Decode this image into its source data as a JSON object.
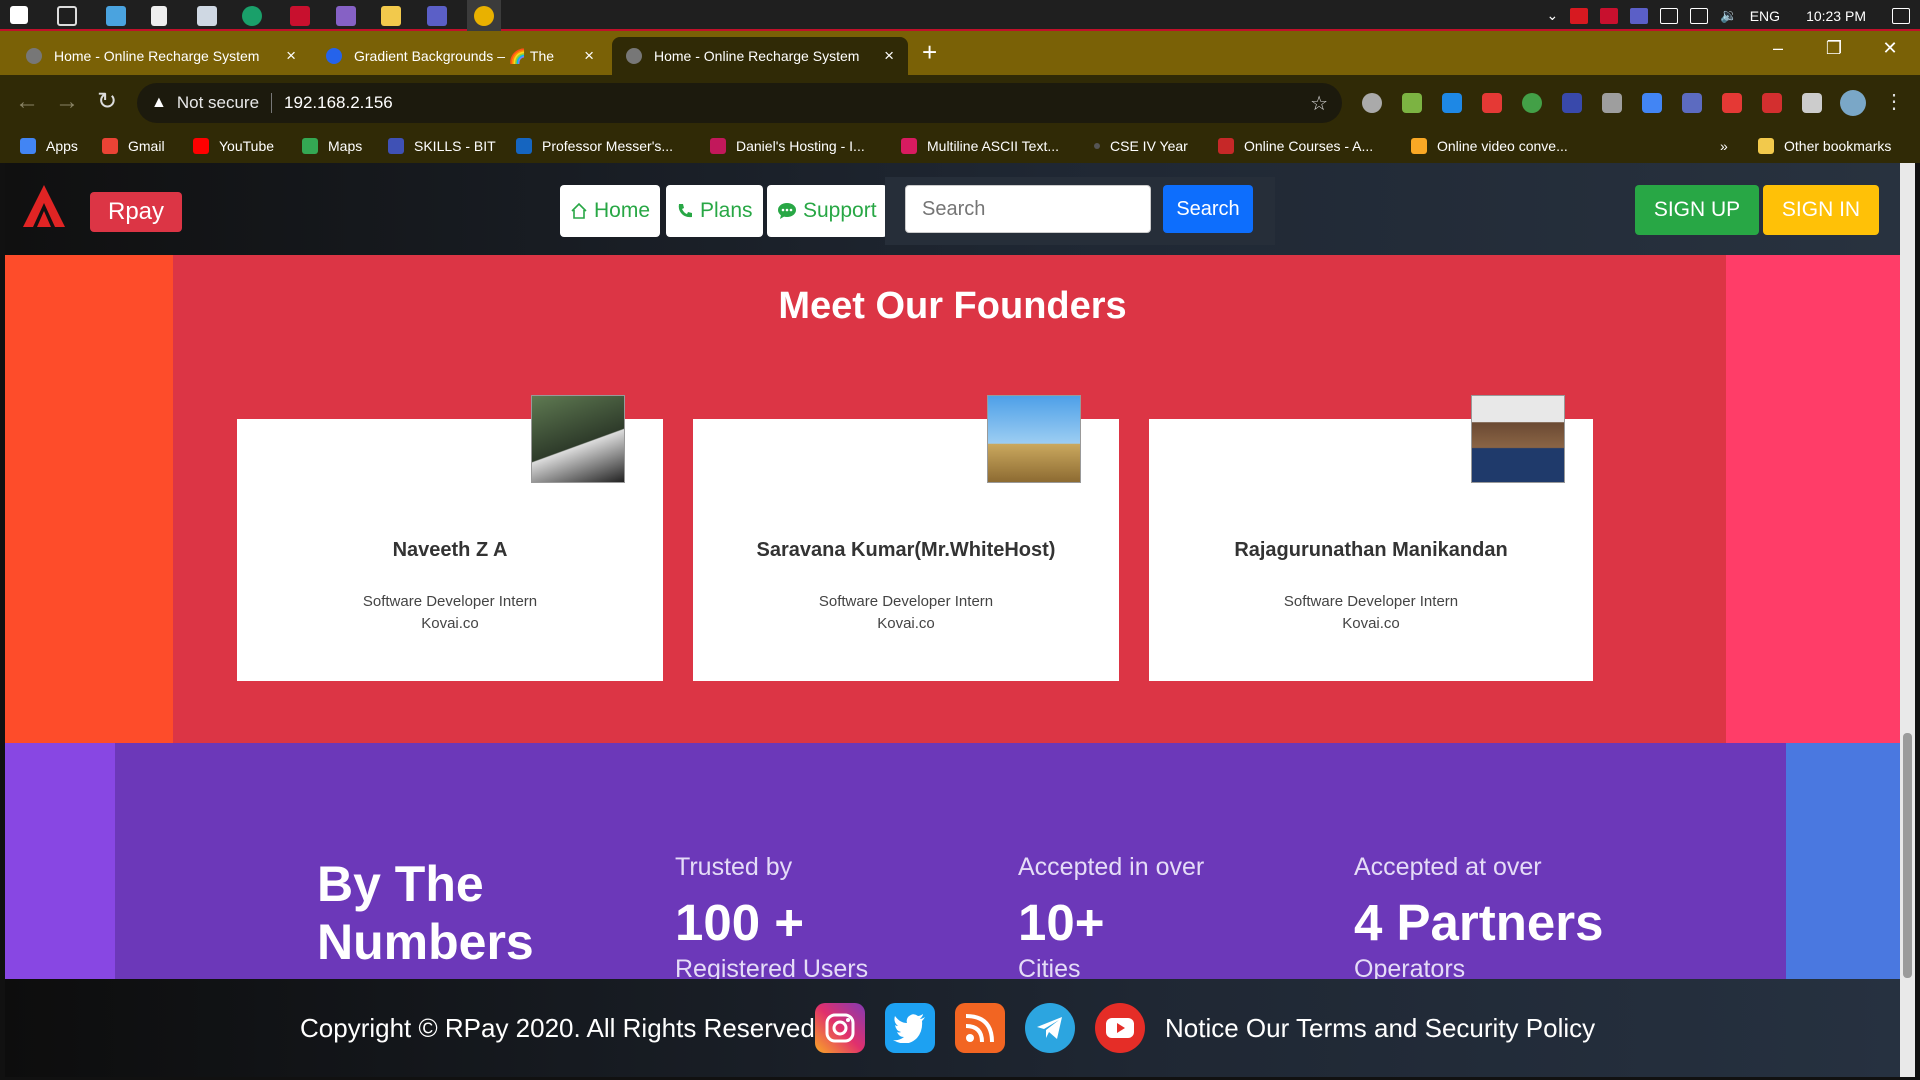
{
  "browser": {
    "tabs": [
      {
        "title": "Home - Online Recharge System",
        "close": "×"
      },
      {
        "title": "Gradient Backgrounds – 🌈 The ",
        "close": "×"
      },
      {
        "title": "Home - Online Recharge System",
        "close": "×"
      }
    ],
    "new_tab": "+",
    "security_label": "Not secure",
    "url": "192.168.2.156",
    "bookmarks": [
      "Apps",
      "Gmail",
      "YouTube",
      "Maps",
      "SKILLS - BIT",
      "Professor Messer's...",
      "Daniel's Hosting - I...",
      "Multiline ASCII Text...",
      "CSE IV Year",
      "Online Courses - A...",
      "Online video conve..."
    ],
    "bookmarks_more": "»",
    "other_bookmarks": "Other bookmarks"
  },
  "system_tray": {
    "language": "ENG",
    "time": "10:23 PM"
  },
  "navbar": {
    "brand": "Rpay",
    "links": [
      {
        "label": "Home",
        "icon": "home-icon"
      },
      {
        "label": "Plans",
        "icon": "phone-icon"
      },
      {
        "label": "Support",
        "icon": "chat-icon"
      }
    ],
    "search_placeholder": "Search",
    "search_button": "Search",
    "signup": "SIGN UP",
    "signin": "SIGN IN"
  },
  "founders": {
    "title": "Meet Our Founders",
    "people": [
      {
        "name": "Naveeth Z A",
        "role": "Software Developer Intern",
        "company": "Kovai.co"
      },
      {
        "name": "Saravana Kumar(Mr.WhiteHost)",
        "role": "Software Developer Intern",
        "company": "Kovai.co"
      },
      {
        "name": "Rajagurunathan Manikandan",
        "role": "Software Developer Intern",
        "company": "Kovai.co"
      }
    ]
  },
  "stats": {
    "title_line1": "By The",
    "title_line2": "Numbers",
    "items": [
      {
        "caption": "Trusted by",
        "value": "100 +",
        "sub": "Registered Users"
      },
      {
        "caption": "Accepted in over",
        "value": "10+",
        "sub": "Cities"
      },
      {
        "caption": "Accepted at over",
        "value": "4 Partners",
        "sub": "Operators"
      }
    ]
  },
  "footer": {
    "copyright": "Copyright © RPay 2020. All Rights Reserved",
    "notice": "Notice Our Terms and Security Policy",
    "social_icons": [
      "instagram-icon",
      "twitter-icon",
      "rss-icon",
      "telegram-icon",
      "youtube-icon"
    ]
  },
  "colors": {
    "brand_red": "#dc3545",
    "signup_green": "#28a745",
    "signin_yellow": "#ffc107",
    "search_blue": "#0d6efd",
    "stats_purple": "#6c38b9"
  }
}
